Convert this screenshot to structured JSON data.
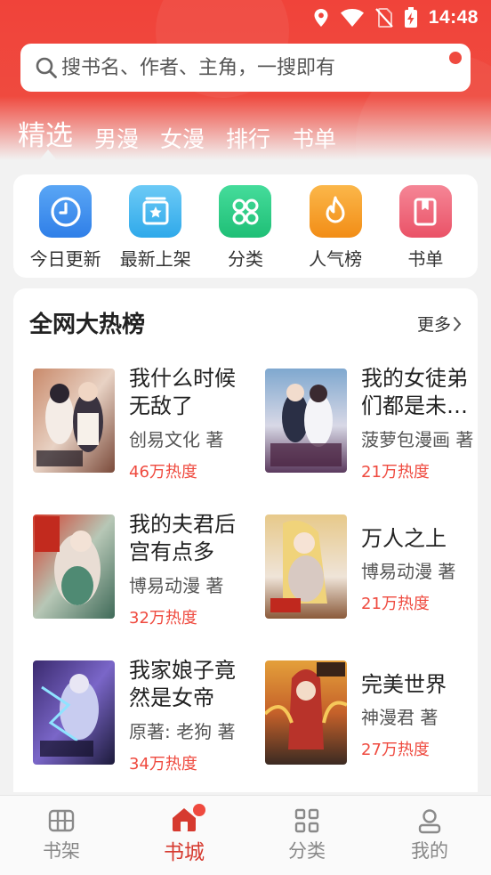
{
  "status_bar": {
    "time": "14:48"
  },
  "search": {
    "placeholder": "搜书名、作者、主角，一搜即有"
  },
  "top_tabs": [
    {
      "label": "精选",
      "active": true
    },
    {
      "label": "男漫",
      "active": false
    },
    {
      "label": "女漫",
      "active": false
    },
    {
      "label": "排行",
      "active": false
    },
    {
      "label": "书单",
      "active": false
    }
  ],
  "shortcuts": [
    {
      "label": "今日更新",
      "icon": "clock-icon",
      "color": "#3b8ff0"
    },
    {
      "label": "最新上架",
      "icon": "new-shelf-icon",
      "color": "#43b6f0"
    },
    {
      "label": "分类",
      "icon": "category-grid-icon",
      "color": "#2fcf8a"
    },
    {
      "label": "人气榜",
      "icon": "flame-icon",
      "color": "#f7a12a"
    },
    {
      "label": "书单",
      "icon": "book-bookmark-icon",
      "color": "#f06a7c"
    }
  ],
  "hot_section": {
    "title": "全网大热榜",
    "more_label": "更多",
    "books": [
      {
        "name": "我什么时候无敌了",
        "author": "创易文化 著",
        "heat": "46万热度"
      },
      {
        "name": "我的女徒弟们都是未来诸天大佬",
        "author": "菠萝包漫画 著",
        "heat": "21万热度"
      },
      {
        "name": "我的夫君后宫有点多",
        "author": "博易动漫 著",
        "heat": "32万热度"
      },
      {
        "name": "万人之上",
        "author": "博易动漫 著",
        "heat": "21万热度"
      },
      {
        "name": "我家娘子竟然是女帝",
        "author": "原著: 老狗 著",
        "heat": "34万热度"
      },
      {
        "name": "完美世界",
        "author": "神漫君 著",
        "heat": "27万热度"
      }
    ]
  },
  "bottom_nav": [
    {
      "label": "书架",
      "icon": "bookshelf-icon",
      "active": false
    },
    {
      "label": "书城",
      "icon": "store-home-icon",
      "active": true
    },
    {
      "label": "分类",
      "icon": "category-icon",
      "active": false
    },
    {
      "label": "我的",
      "icon": "profile-icon",
      "active": false
    }
  ],
  "colors": {
    "brand_red": "#ef4a3f",
    "heat_red": "#ef4a3f",
    "active_nav": "#d63a2f"
  }
}
